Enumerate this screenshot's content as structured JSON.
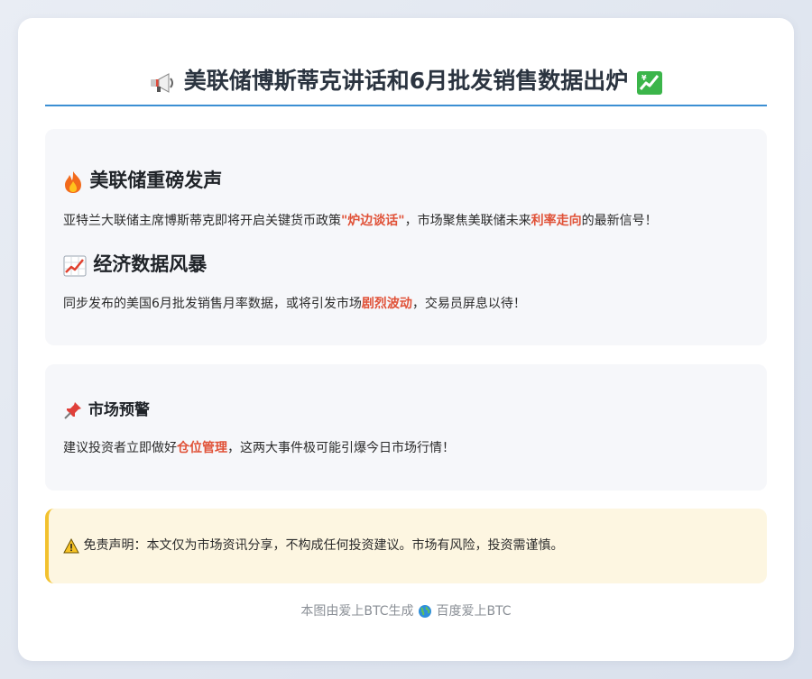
{
  "header": {
    "title": "美联储博斯蒂克讲话和6月批发销售数据出炉",
    "left_icon": "megaphone-icon",
    "right_icon": "chart-increasing-icon"
  },
  "section1": {
    "heading1": {
      "icon": "fire-icon",
      "text": "美联储重磅发声"
    },
    "para1": {
      "part1": "亚特兰大联储主席博斯蒂克即将开启关键货币政策",
      "highlight1": "\"炉边谈话\"",
      "part2": "，市场聚焦美联储未来",
      "highlight2": "利率走向",
      "part3": "的最新信号！"
    },
    "heading2": {
      "icon": "chart-increasing-icon",
      "text": "经济数据风暴"
    },
    "para2": {
      "part1": "同步发布的美国6月批发销售月率数据，或将引发市场",
      "highlight1": "剧烈波动",
      "part2": "，交易员屏息以待！"
    }
  },
  "section2": {
    "heading": {
      "icon": "pushpin-icon",
      "text": "市场预警"
    },
    "para": {
      "part1": "建议投资者立即做好",
      "highlight1": "仓位管理",
      "part2": "，这两大事件极可能引爆今日市场行情！"
    }
  },
  "disclaimer": {
    "icon": "warning-icon",
    "text": "免责声明：本文仅为市场资讯分享，不构成任何投资建议。市场有风险，投资需谨慎。"
  },
  "footer": {
    "text1": "本图由爱上BTC生成",
    "icon": "globe-icon",
    "text2": "百度爱上BTC"
  },
  "colors": {
    "accent": "#3b8fd3",
    "highlight": "#e05238",
    "warning_border": "#f2c12e",
    "warning_bg": "#fdf6e1"
  }
}
